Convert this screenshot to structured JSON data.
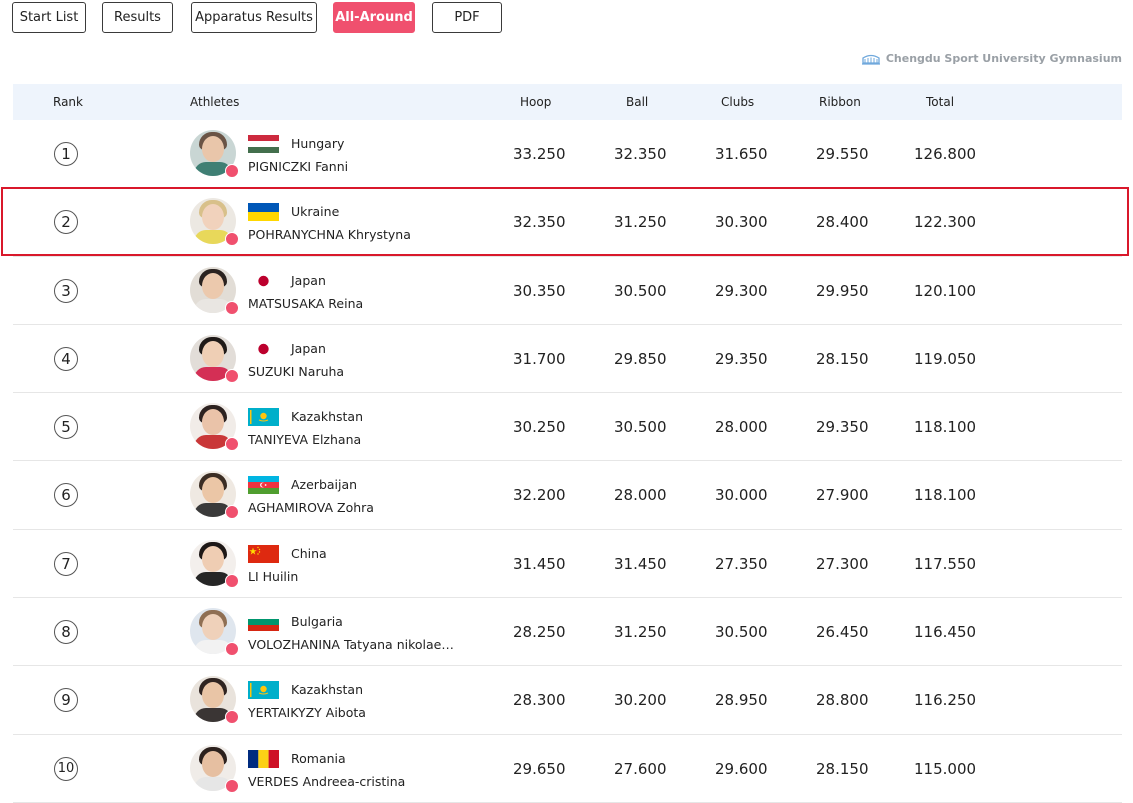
{
  "tabs": [
    {
      "label": "Start List",
      "active": false
    },
    {
      "label": "Results",
      "active": false
    },
    {
      "label": "Apparatus Results",
      "active": false
    },
    {
      "label": "All-Around",
      "active": true
    },
    {
      "label": "PDF",
      "active": false
    }
  ],
  "venue": "Chengdu Sport University Gymnasium",
  "columns": {
    "rank": "Rank",
    "athletes": "Athletes",
    "hoop": "Hoop",
    "ball": "Ball",
    "clubs": "Clubs",
    "ribbon": "Ribbon",
    "total": "Total"
  },
  "accent_color": "#f0506e",
  "highlight_color": "#d9182b",
  "rows": [
    {
      "rank": "1",
      "country": "Hungary",
      "athlete": "PIGNICZKI Fanni",
      "hoop": "33.250",
      "ball": "32.350",
      "clubs": "31.650",
      "ribbon": "29.550",
      "total": "126.800",
      "flag": "hungary"
    },
    {
      "rank": "2",
      "country": "Ukraine",
      "athlete": "POHRANYCHNA Khrystyna",
      "hoop": "32.350",
      "ball": "31.250",
      "clubs": "30.300",
      "ribbon": "28.400",
      "total": "122.300",
      "flag": "ukraine",
      "highlighted": true
    },
    {
      "rank": "3",
      "country": "Japan",
      "athlete": "MATSUSAKA Reina",
      "hoop": "30.350",
      "ball": "30.500",
      "clubs": "29.300",
      "ribbon": "29.950",
      "total": "120.100",
      "flag": "japan"
    },
    {
      "rank": "4",
      "country": "Japan",
      "athlete": "SUZUKI Naruha",
      "hoop": "31.700",
      "ball": "29.850",
      "clubs": "29.350",
      "ribbon": "28.150",
      "total": "119.050",
      "flag": "japan"
    },
    {
      "rank": "5",
      "country": "Kazakhstan",
      "athlete": "TANIYEVA Elzhana",
      "hoop": "30.250",
      "ball": "30.500",
      "clubs": "28.000",
      "ribbon": "29.350",
      "total": "118.100",
      "flag": "kazakhstan"
    },
    {
      "rank": "6",
      "country": "Azerbaijan",
      "athlete": "AGHAMIROVA Zohra",
      "hoop": "32.200",
      "ball": "28.000",
      "clubs": "30.000",
      "ribbon": "27.900",
      "total": "118.100",
      "flag": "azerbaijan"
    },
    {
      "rank": "7",
      "country": "China",
      "athlete": "LI Huilin",
      "hoop": "31.450",
      "ball": "31.450",
      "clubs": "27.350",
      "ribbon": "27.300",
      "total": "117.550",
      "flag": "china"
    },
    {
      "rank": "8",
      "country": "Bulgaria",
      "athlete": "VOLOZHANINA Tatyana nikolae…",
      "hoop": "28.250",
      "ball": "31.250",
      "clubs": "30.500",
      "ribbon": "26.450",
      "total": "116.450",
      "flag": "bulgaria"
    },
    {
      "rank": "9",
      "country": "Kazakhstan",
      "athlete": "YERTAIKYZY Aibota",
      "hoop": "28.300",
      "ball": "30.200",
      "clubs": "28.950",
      "ribbon": "28.800",
      "total": "116.250",
      "flag": "kazakhstan"
    },
    {
      "rank": "10",
      "country": "Romania",
      "athlete": "VERDES Andreea-cristina",
      "hoop": "29.650",
      "ball": "27.600",
      "clubs": "29.600",
      "ribbon": "28.150",
      "total": "115.000",
      "flag": "romania"
    }
  ]
}
